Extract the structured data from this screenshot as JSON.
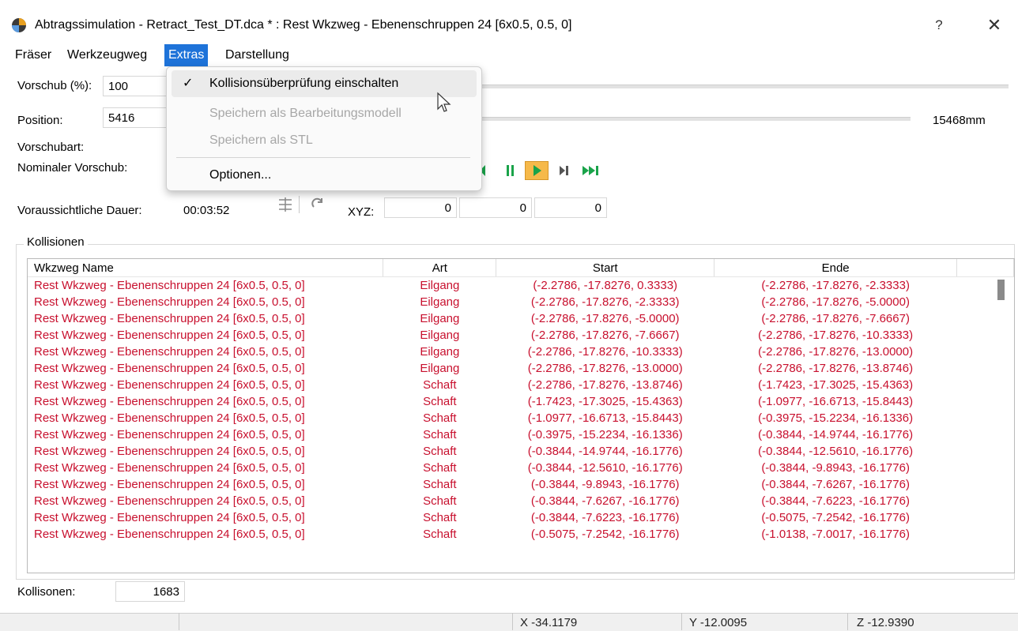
{
  "window": {
    "title": "Abtragssimulation - Retract_Test_DT.dca * : Rest Wkzweg - Ebenenschruppen 24 [6x0.5, 0.5, 0]",
    "help": "?",
    "close": "✕"
  },
  "menu": {
    "items": [
      "Fräser",
      "Werkzeugweg",
      "Extras",
      "Darstellung"
    ],
    "active": "Extras"
  },
  "dropdown": {
    "check": "✓",
    "items": [
      {
        "label": "Kollisionsüberprüfung einschalten",
        "enabled": true,
        "checked": true
      },
      {
        "label": "Speichern als Bearbeitungsmodell",
        "enabled": false
      },
      {
        "label": "Speichern als STL",
        "enabled": false
      },
      {
        "label": "Optionen...",
        "enabled": true
      }
    ]
  },
  "form": {
    "vorschub_label": "Vorschub (%):",
    "vorschub_value": "100",
    "position_label": "Position:",
    "position_value": "5416",
    "position_total": "15468mm",
    "vorschubart_label": "Vorschubart:",
    "nominal_label": "Nominaler Vorschub:",
    "dauer_label": "Voraussichtliche Dauer:",
    "dauer_value": "00:03:52",
    "xyz_label": "XYZ:",
    "xyz": [
      "0",
      "0",
      "0"
    ]
  },
  "kollisionen": {
    "group_label": "Kollisionen",
    "columns": [
      "Wkzweg Name",
      "Art",
      "Start",
      "Ende"
    ],
    "rows": [
      [
        "Rest Wkzweg - Ebenenschruppen 24 [6x0.5, 0.5, 0]",
        "Eilgang",
        "(-2.2786, -17.8276, 0.3333)",
        "(-2.2786, -17.8276, -2.3333)"
      ],
      [
        "Rest Wkzweg - Ebenenschruppen 24 [6x0.5, 0.5, 0]",
        "Eilgang",
        "(-2.2786, -17.8276, -2.3333)",
        "(-2.2786, -17.8276, -5.0000)"
      ],
      [
        "Rest Wkzweg - Ebenenschruppen 24 [6x0.5, 0.5, 0]",
        "Eilgang",
        "(-2.2786, -17.8276, -5.0000)",
        "(-2.2786, -17.8276, -7.6667)"
      ],
      [
        "Rest Wkzweg - Ebenenschruppen 24 [6x0.5, 0.5, 0]",
        "Eilgang",
        "(-2.2786, -17.8276, -7.6667)",
        "(-2.2786, -17.8276, -10.3333)"
      ],
      [
        "Rest Wkzweg - Ebenenschruppen 24 [6x0.5, 0.5, 0]",
        "Eilgang",
        "(-2.2786, -17.8276, -10.3333)",
        "(-2.2786, -17.8276, -13.0000)"
      ],
      [
        "Rest Wkzweg - Ebenenschruppen 24 [6x0.5, 0.5, 0]",
        "Eilgang",
        "(-2.2786, -17.8276, -13.0000)",
        "(-2.2786, -17.8276, -13.8746)"
      ],
      [
        "Rest Wkzweg - Ebenenschruppen 24 [6x0.5, 0.5, 0]",
        "Schaft",
        "(-2.2786, -17.8276, -13.8746)",
        "(-1.7423, -17.3025, -15.4363)"
      ],
      [
        "Rest Wkzweg - Ebenenschruppen 24 [6x0.5, 0.5, 0]",
        "Schaft",
        "(-1.7423, -17.3025, -15.4363)",
        "(-1.0977, -16.6713, -15.8443)"
      ],
      [
        "Rest Wkzweg - Ebenenschruppen 24 [6x0.5, 0.5, 0]",
        "Schaft",
        "(-1.0977, -16.6713, -15.8443)",
        "(-0.3975, -15.2234, -16.1336)"
      ],
      [
        "Rest Wkzweg - Ebenenschruppen 24 [6x0.5, 0.5, 0]",
        "Schaft",
        "(-0.3975, -15.2234, -16.1336)",
        "(-0.3844, -14.9744, -16.1776)"
      ],
      [
        "Rest Wkzweg - Ebenenschruppen 24 [6x0.5, 0.5, 0]",
        "Schaft",
        "(-0.3844, -14.9744, -16.1776)",
        "(-0.3844, -12.5610, -16.1776)"
      ],
      [
        "Rest Wkzweg - Ebenenschruppen 24 [6x0.5, 0.5, 0]",
        "Schaft",
        "(-0.3844, -12.5610, -16.1776)",
        "(-0.3844, -9.8943, -16.1776)"
      ],
      [
        "Rest Wkzweg - Ebenenschruppen 24 [6x0.5, 0.5, 0]",
        "Schaft",
        "(-0.3844, -9.8943, -16.1776)",
        "(-0.3844, -7.6267, -16.1776)"
      ],
      [
        "Rest Wkzweg - Ebenenschruppen 24 [6x0.5, 0.5, 0]",
        "Schaft",
        "(-0.3844, -7.6267, -16.1776)",
        "(-0.3844, -7.6223, -16.1776)"
      ],
      [
        "Rest Wkzweg - Ebenenschruppen 24 [6x0.5, 0.5, 0]",
        "Schaft",
        "(-0.3844, -7.6223, -16.1776)",
        "(-0.5075, -7.2542, -16.1776)"
      ],
      [
        "Rest Wkzweg - Ebenenschruppen 24 [6x0.5, 0.5, 0]",
        "Schaft",
        "(-0.5075, -7.2542, -16.1776)",
        "(-1.0138, -7.0017, -16.1776)"
      ]
    ],
    "count_label": "Kollisonen:",
    "count_value": "1683"
  },
  "statusbar": {
    "x": "X  -34.1179",
    "y": "Y  -12.0095",
    "z": "Z  -12.9390"
  },
  "colors": {
    "row_text": "#c8102e",
    "menu_active": "#1e73d9",
    "play_highlight": "#f6b94a",
    "media_green": "#1aa34a"
  }
}
